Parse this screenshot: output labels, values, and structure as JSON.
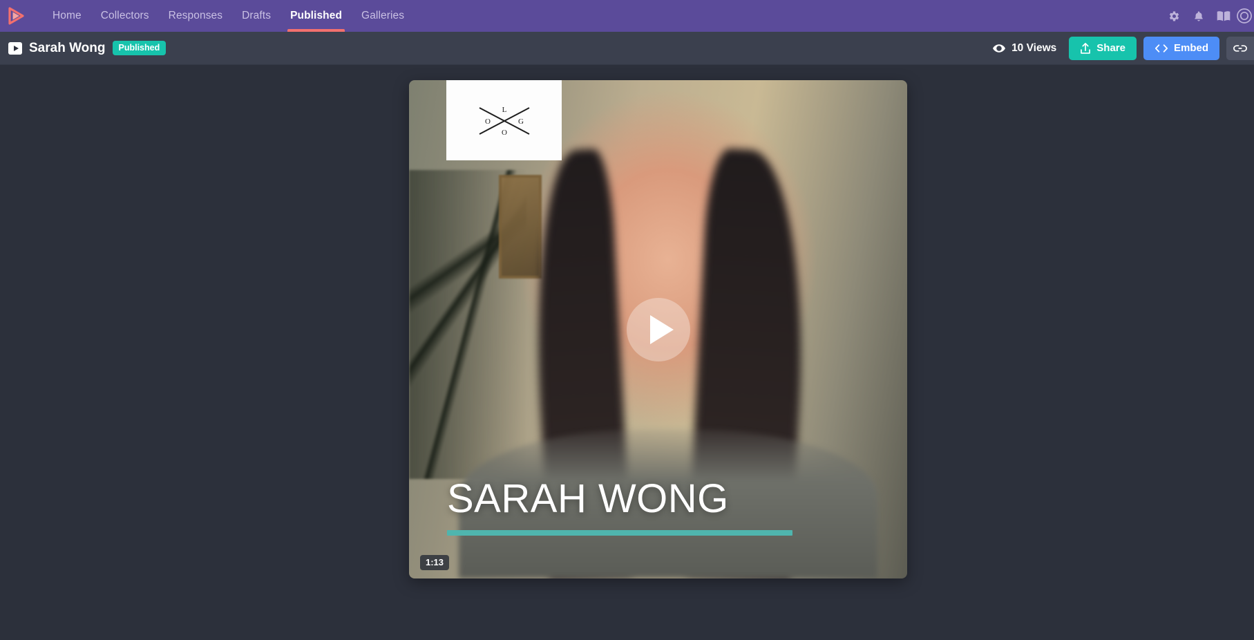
{
  "topnav": {
    "brand_icon": "play-logo-icon",
    "brand_color": "#f2706e",
    "background": "#5b4b9a",
    "active_underline_color": "#f2706e",
    "links": [
      {
        "label": "Home",
        "active": false
      },
      {
        "label": "Collectors",
        "active": false
      },
      {
        "label": "Responses",
        "active": false
      },
      {
        "label": "Drafts",
        "active": false
      },
      {
        "label": "Published",
        "active": true
      },
      {
        "label": "Galleries",
        "active": false
      }
    ],
    "icons": [
      {
        "name": "gear-icon"
      },
      {
        "name": "bell-icon"
      },
      {
        "name": "book-icon"
      },
      {
        "name": "help-circle-icon"
      }
    ]
  },
  "subbar": {
    "background": "#3b404e",
    "video_icon": "video-play-icon",
    "title": "Sarah Wong",
    "status_badge": "Published",
    "status_badge_color": "#17c3ac",
    "views": {
      "icon": "eye-icon",
      "label": "10 Views"
    },
    "buttons": [
      {
        "name": "share-button",
        "label": "Share",
        "icon": "upload-icon",
        "color": "#17c3ac"
      },
      {
        "name": "embed-button",
        "label": "Embed",
        "icon": "code-brackets-icon",
        "color": "#4d8df6"
      },
      {
        "name": "copy-link-button",
        "label": "",
        "icon": "link-icon",
        "color": "#4d5263"
      }
    ]
  },
  "player": {
    "logo_overlay": {
      "letters": [
        "L",
        "O",
        "G",
        "O"
      ],
      "shape": "x-cross-logo-icon"
    },
    "play_button_icon": "play-triangle-icon",
    "lower_third_name": "SARAH WONG",
    "progress_bar_color": "#4fb5ae",
    "duration": "1:13"
  },
  "stage": {
    "background": "#2c303b"
  }
}
